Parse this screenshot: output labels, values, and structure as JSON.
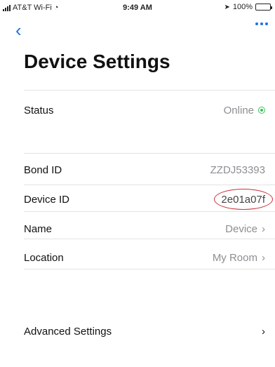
{
  "status_bar": {
    "carrier": "AT&T Wi-Fi",
    "time": "9:49 AM",
    "battery": "100%",
    "battery_level": 1.0
  },
  "nav": {
    "back_icon": "chevron-left-icon",
    "more_icon": "ellipsis-icon",
    "accent": "#1a73e8"
  },
  "page": {
    "title": "Device Settings"
  },
  "rows": {
    "status": {
      "label": "Status",
      "value": "Online"
    },
    "bond_id": {
      "label": "Bond ID",
      "value": "ZZDJ53393"
    },
    "device_id": {
      "label": "Device ID",
      "value": "2e01a07f"
    },
    "name": {
      "label": "Name",
      "value": "Device"
    },
    "location": {
      "label": "Location",
      "value": "My Room"
    },
    "advanced": {
      "label": "Advanced Settings"
    }
  },
  "colors": {
    "online": "#3cc15a",
    "annotation": "#c8323a"
  }
}
